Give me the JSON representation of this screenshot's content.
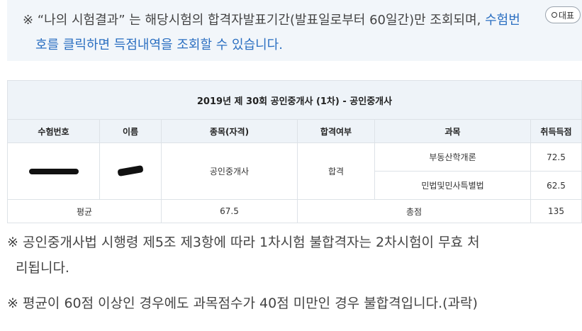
{
  "notice": {
    "line1_text": "※ “나의 시험결과” 는 해당시험의 합격자발표기간(발표일로부터 60일간)만 조회되며,",
    "line1_link": "수험번",
    "line2": "호를 클릭하면 득점내역을 조회할 수 있습니다.",
    "enlarge_button": "대표"
  },
  "table": {
    "caption": "2019년 제 30회 공인중개사 (1차) - 공인중개사",
    "headers": [
      "수험번호",
      "이름",
      "종목(자격)",
      "합격여부",
      "과목",
      "취득득점"
    ],
    "row": {
      "exam_type": "공인중개사",
      "result": "합격",
      "subjects": [
        {
          "name": "부동산학개론",
          "score": "72.5"
        },
        {
          "name": "민법및민사특별법",
          "score": "62.5"
        }
      ]
    },
    "summary": {
      "avg_label": "평균",
      "avg_value": "67.5",
      "total_label": "총점",
      "total_value": "135"
    }
  },
  "notes": [
    "※ 공인중개사법 시행령 제5조 제3항에 따라 1차시험 불합격자는 2차시험이 무효 처",
    "리됩니다.",
    "※ 평균이 60점 이상인 경우에도 과목점수가 40점 미만인 경우 불합격입니다.(과락)"
  ]
}
